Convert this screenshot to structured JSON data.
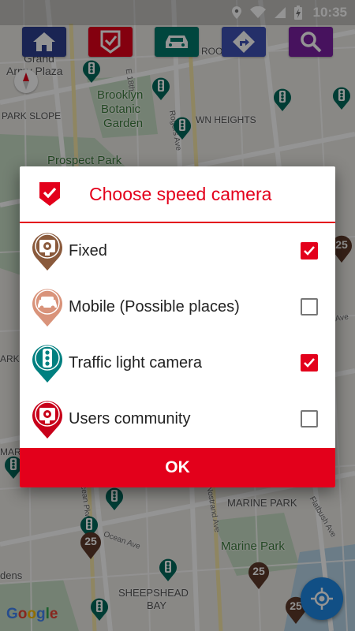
{
  "status_bar": {
    "time": "10:35",
    "icons": [
      "location-icon",
      "wifi-icon",
      "signal-icon",
      "battery-charging-icon"
    ]
  },
  "toolbar": {
    "buttons": [
      {
        "name": "home",
        "icon": "home-icon",
        "color": "#2e3f8f"
      },
      {
        "name": "speed-camera-filter",
        "icon": "check-shield-icon",
        "color": "#e3001b"
      },
      {
        "name": "car",
        "icon": "car-icon",
        "color": "#00796b"
      },
      {
        "name": "directions",
        "icon": "directions-icon",
        "color": "#3f51b5"
      },
      {
        "name": "search",
        "icon": "search-icon",
        "color": "#7b1fa2"
      }
    ]
  },
  "map": {
    "labels": [
      {
        "text": "Grand",
        "kind": "place"
      },
      {
        "text": "Army Plaza",
        "kind": "place"
      },
      {
        "text": "Brooklyn",
        "kind": "green"
      },
      {
        "text": "Botanic",
        "kind": "green"
      },
      {
        "text": "Garden",
        "kind": "green"
      },
      {
        "text": "PARK SLOPE",
        "kind": "place"
      },
      {
        "text": "WN HEIGHTS",
        "kind": "place"
      },
      {
        "text": "Prospect Park",
        "kind": "green"
      },
      {
        "text": "ROO",
        "kind": "place"
      },
      {
        "text": "MARINE PARK",
        "kind": "place"
      },
      {
        "text": "Marine Park",
        "kind": "green"
      },
      {
        "text": "SHEEPSHEAD",
        "kind": "place"
      },
      {
        "text": "BAY",
        "kind": "place"
      },
      {
        "text": "Rogers Ave",
        "kind": "street"
      },
      {
        "text": "Nostrand Ave",
        "kind": "street"
      },
      {
        "text": "Flatbush Ave",
        "kind": "street"
      },
      {
        "text": "Ocean Pkwy",
        "kind": "street"
      },
      {
        "text": "Ocean Ave",
        "kind": "street"
      },
      {
        "text": "E 18th",
        "kind": "street"
      },
      {
        "text": "Utica Ave",
        "kind": "street"
      },
      {
        "text": "ARK",
        "kind": "place"
      },
      {
        "text": "dens",
        "kind": "place"
      },
      {
        "text": "MAR",
        "kind": "place"
      }
    ],
    "speed_limit_badge": "25",
    "attribution": "Google"
  },
  "dialog": {
    "title": "Choose speed camera",
    "options": [
      {
        "label": "Fixed",
        "checked": true,
        "icon": "fixed-camera-icon",
        "color": "#8a5a3c"
      },
      {
        "label": "Mobile (Possible places)",
        "checked": false,
        "icon": "mobile-camera-icon",
        "color": "#d9937a"
      },
      {
        "label": "Traffic light camera",
        "checked": true,
        "icon": "traffic-light-icon",
        "color": "#008080"
      },
      {
        "label": "Users community",
        "checked": false,
        "icon": "community-camera-icon",
        "color": "#c8001a"
      }
    ],
    "ok_label": "OK",
    "accent_color": "#e3001b"
  },
  "fab": {
    "icon": "my-location-icon",
    "color": "#1e88e5"
  }
}
